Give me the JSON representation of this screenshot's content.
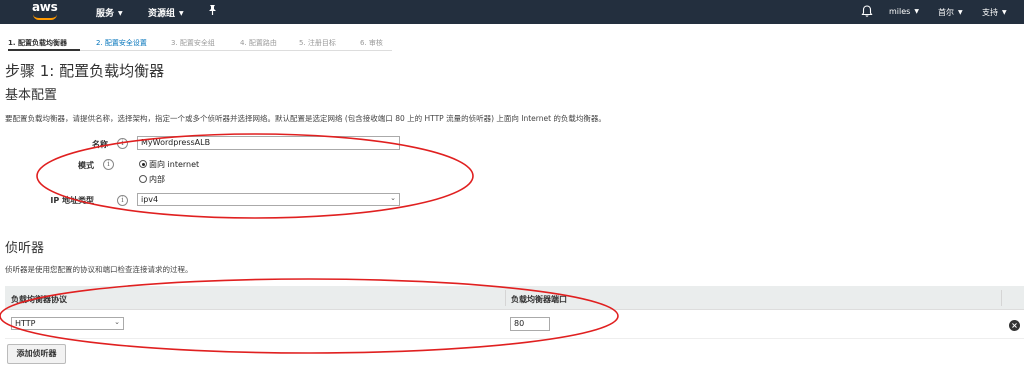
{
  "topnav": {
    "logo": "aws",
    "services": "服务",
    "resource_groups": "资源组",
    "user": "miles",
    "region": "首尔",
    "support": "支持"
  },
  "steps": [
    {
      "label": "1. 配置负载均衡器"
    },
    {
      "label": "2. 配置安全设置"
    },
    {
      "label": "3. 配置安全组"
    },
    {
      "label": "4. 配置路由"
    },
    {
      "label": "5. 注册目标"
    },
    {
      "label": "6. 审核"
    }
  ],
  "page_title": "步骤 1: 配置负载均衡器",
  "basic": {
    "heading": "基本配置",
    "description": "要配置负载均衡器，请提供名称，选择架构，指定一个或多个侦听器并选择网络。默认配置是选定网络 (包含接收端口 80 上的 HTTP 流量的侦听器) 上面向 Internet 的负载均衡器。",
    "name_label": "名称",
    "name_value": "MyWordpressALB",
    "scheme_label": "模式",
    "scheme_options": [
      "面向 internet",
      "内部"
    ],
    "scheme_selected": "面向 internet",
    "ip_label": "IP 地址类型",
    "ip_value": "ipv4"
  },
  "listeners": {
    "heading": "侦听器",
    "description": "侦听器是使用您配置的协议和端口检查连接请求的过程。",
    "col_protocol": "负载均衡器协议",
    "col_port": "负载均衡器端口",
    "row_protocol": "HTTP",
    "row_port": "80",
    "add_button": "添加侦听器"
  },
  "icons": {
    "info": "info-icon",
    "remove": "remove-circle-icon",
    "bell": "bell-icon",
    "pin": "pin-icon"
  },
  "colors": {
    "nav_bg": "#232f3e",
    "brand_orange": "#ff9900",
    "link_blue": "#0073bb",
    "annotation_red": "#e02020"
  }
}
